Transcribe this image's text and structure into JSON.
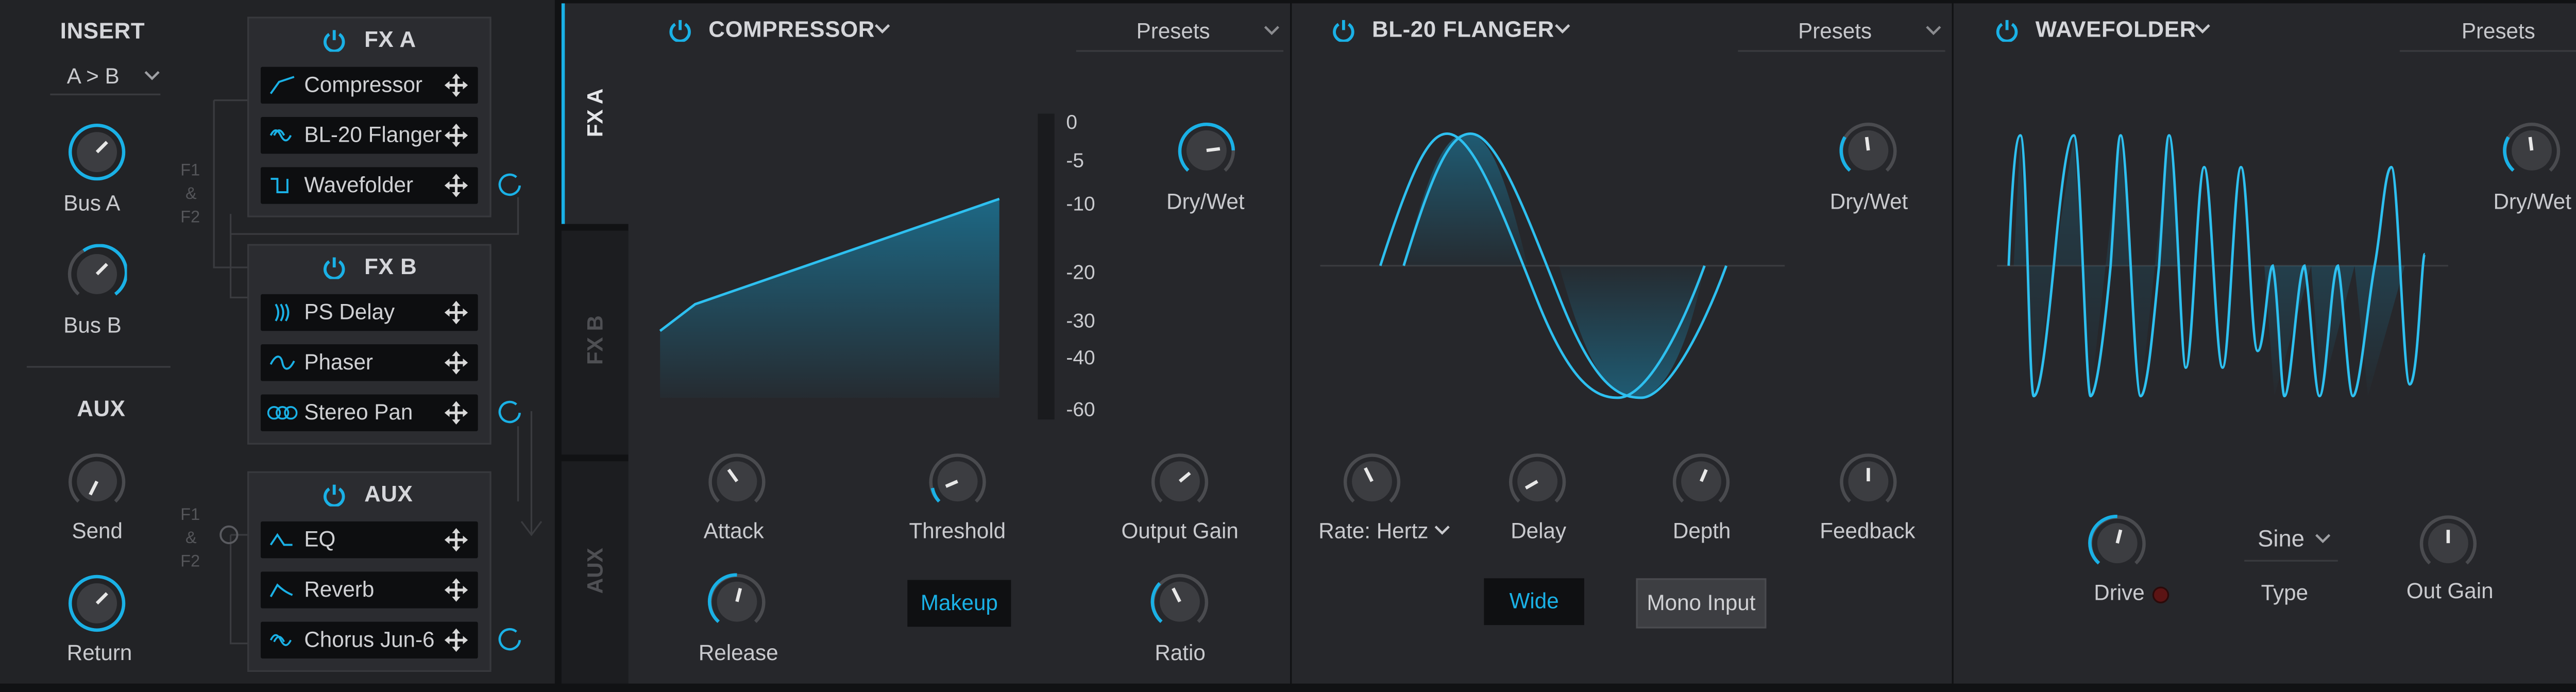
{
  "colors": {
    "accent": "#1ab1e6",
    "panel": "#26272b",
    "sidebar": "#222326",
    "background": "#111214",
    "slot": "#0d0e10"
  },
  "insert": {
    "title": "INSERT",
    "routing_value": "A > B",
    "bus_a_label": "Bus A",
    "bus_b_label": "Bus B",
    "aux_title": "AUX",
    "send_label": "Send",
    "return_label": "Return",
    "f1_label": "F1",
    "amp_label": "&",
    "f2_label": "F2"
  },
  "chains": {
    "fx_a": {
      "title": "FX A",
      "slots": [
        {
          "label": "Compressor",
          "icon": "compressor-icon"
        },
        {
          "label": "BL-20 Flanger",
          "icon": "flanger-icon"
        },
        {
          "label": "Wavefolder",
          "icon": "wavefolder-icon"
        }
      ]
    },
    "fx_b": {
      "title": "FX B",
      "slots": [
        {
          "label": "PS Delay",
          "icon": "delay-icon"
        },
        {
          "label": "Phaser",
          "icon": "phaser-icon"
        },
        {
          "label": "Stereo Pan",
          "icon": "stereo-pan-icon"
        }
      ]
    },
    "aux": {
      "title": "AUX",
      "slots": [
        {
          "label": "EQ",
          "icon": "eq-icon"
        },
        {
          "label": "Reverb",
          "icon": "reverb-icon"
        },
        {
          "label": "Chorus Jun-6",
          "icon": "chorus-icon"
        }
      ]
    }
  },
  "tabs": [
    {
      "label": "FX A",
      "active": true
    },
    {
      "label": "FX B",
      "active": false
    },
    {
      "label": "AUX",
      "active": false
    }
  ],
  "compressor": {
    "title": "COMPRESSOR",
    "presets_label": "Presets",
    "meter_scale": [
      "0",
      "-5",
      "-10",
      "-20",
      "-30",
      "-40",
      "-60"
    ],
    "dry_wet_label": "Dry/Wet",
    "attack_label": "Attack",
    "threshold_label": "Threshold",
    "output_gain_label": "Output Gain",
    "release_label": "Release",
    "makeup_label": "Makeup",
    "ratio_label": "Ratio"
  },
  "flanger": {
    "title": "BL-20 FLANGER",
    "presets_label": "Presets",
    "dry_wet_label": "Dry/Wet",
    "rate_label": "Rate: Hertz",
    "delay_label": "Delay",
    "depth_label": "Depth",
    "feedback_label": "Feedback",
    "wide_label": "Wide",
    "mono_input_label": "Mono Input"
  },
  "wavefolder": {
    "title": "WAVEFOLDER",
    "presets_label": "Presets",
    "dry_wet_label": "Dry/Wet",
    "drive_label": "Drive",
    "type_value": "Sine",
    "type_label": "Type",
    "out_gain_label": "Out Gain"
  }
}
